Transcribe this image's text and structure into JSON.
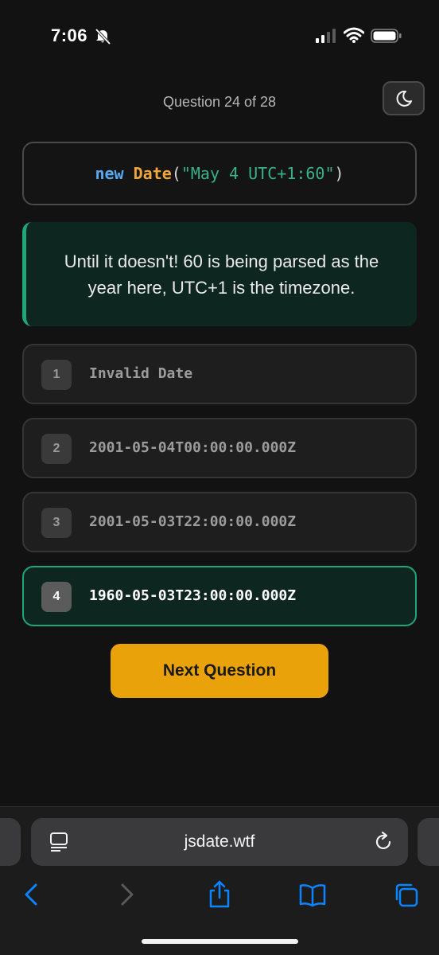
{
  "status_bar": {
    "time": "7:06"
  },
  "header": {
    "question_counter": "Question 24 of 28"
  },
  "code": {
    "keyword": "new",
    "class_name": "Date",
    "open_paren": "(",
    "argument": "\"May 4 UTC+1:60\"",
    "close_paren": ")"
  },
  "explanation": "Until it doesn't! 60 is being parsed as the year here, UTC+1 is the timezone.",
  "options": [
    {
      "number": "1",
      "text": "Invalid Date"
    },
    {
      "number": "2",
      "text": "2001-05-04T00:00:00.000Z"
    },
    {
      "number": "3",
      "text": "2001-05-03T22:00:00.000Z"
    },
    {
      "number": "4",
      "text": "1960-05-03T23:00:00.000Z",
      "state": "correct"
    }
  ],
  "next_button_label": "Next Question",
  "browser": {
    "url": "jsdate.wtf"
  },
  "colors": {
    "accent_green": "#1fa57a",
    "button_yellow": "#eaa20a",
    "ios_blue": "#0a84ff"
  }
}
